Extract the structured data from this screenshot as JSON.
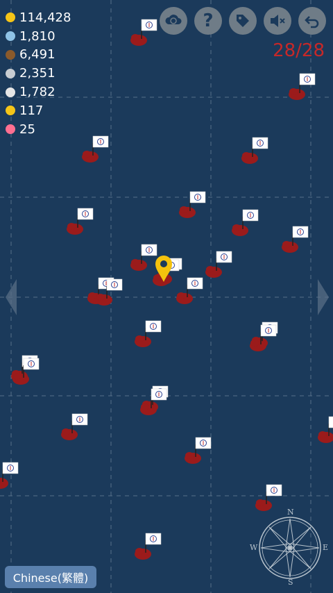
{
  "resources": [
    {
      "icon": "gold-coin-icon",
      "value": "114,428",
      "color": "#f5c518"
    },
    {
      "icon": "fish-icon",
      "value": "1,810",
      "color": "#8fc3e6"
    },
    {
      "icon": "wood-icon",
      "value": "6,491",
      "color": "#8a5a2b"
    },
    {
      "icon": "stone-icon",
      "value": "2,351",
      "color": "#c8cdd2"
    },
    {
      "icon": "iron-icon",
      "value": "1,782",
      "color": "#e6e6e6"
    },
    {
      "icon": "gold-bar-icon",
      "value": "117",
      "color": "#f5c518"
    },
    {
      "icon": "gem-icon",
      "value": "25",
      "color": "#ff6f91"
    }
  ],
  "toolbar": [
    "cloud-sync-button",
    "help-button",
    "tag-button",
    "mute-button",
    "back-button"
  ],
  "counter": "28/28",
  "language_button": "Chinese(繁體)",
  "compass": {
    "n": "N",
    "e": "E",
    "s": "S",
    "w": "W"
  },
  "colors": {
    "ocean": "#1b3a5b",
    "island": "#9b1b1b",
    "counter": "#c62828",
    "marker": "#f4c20d"
  },
  "island_count": 28
}
